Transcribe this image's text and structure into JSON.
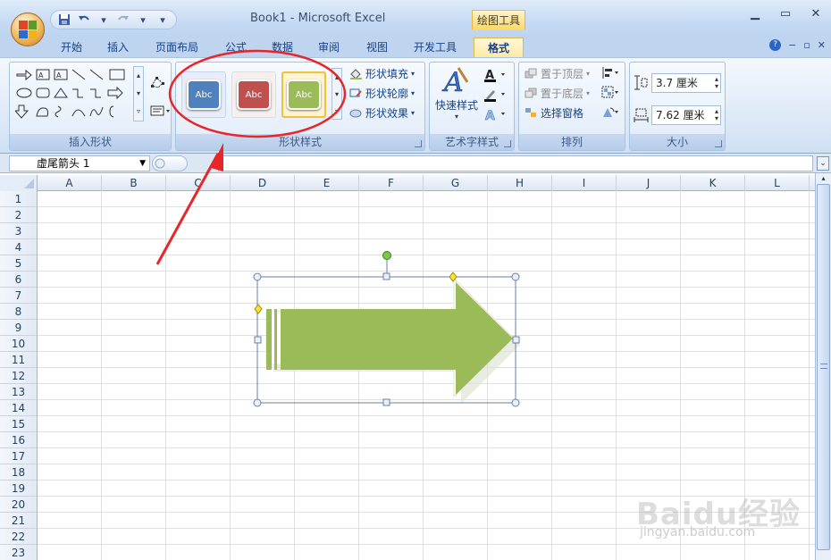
{
  "window": {
    "title": "Book1 - Microsoft Excel",
    "context_tab": "绘图工具",
    "min": "▁",
    "max": "▭",
    "close": "✕"
  },
  "qat": {
    "more": "▾"
  },
  "tabs": [
    "开始",
    "插入",
    "页面布局",
    "公式",
    "数据",
    "审阅",
    "视图",
    "开发工具",
    "格式"
  ],
  "ribbon_ctrl": {
    "help": "?",
    "min": "−",
    "restore": "▫",
    "close": "✕"
  },
  "groups": {
    "insert_shapes": {
      "label": "插入形状"
    },
    "shape_styles": {
      "label": "形状样式",
      "fill": "形状填充",
      "outline": "形状轮廓",
      "effects": "形状效果",
      "styles": [
        {
          "text": "Abc",
          "color": "#4f81bd"
        },
        {
          "text": "Abc",
          "color": "#c0504d"
        },
        {
          "text": "Abc",
          "color": "#9bbb59"
        }
      ]
    },
    "wordart": {
      "label": "艺术字样式",
      "quick": "快速样式"
    },
    "arrange": {
      "label": "排列",
      "front": "置于顶层",
      "back": "置于底层",
      "pane": "选择窗格"
    },
    "size": {
      "label": "大小",
      "height": "3.7 厘米",
      "width": "7.62 厘米"
    }
  },
  "formula_bar": {
    "name_box": "虚尾箭头 1",
    "formula": ""
  },
  "columns": [
    "A",
    "B",
    "C",
    "D",
    "E",
    "F",
    "G",
    "H",
    "I",
    "J",
    "K",
    "L"
  ],
  "rows": [
    "1",
    "2",
    "3",
    "4",
    "5",
    "6",
    "7",
    "8",
    "9",
    "10",
    "11",
    "12",
    "13",
    "14",
    "15",
    "16",
    "17",
    "18",
    "19",
    "20",
    "21",
    "22",
    "23"
  ],
  "shape": {
    "name": "虚尾箭头 1",
    "fill": "#9bbb59"
  },
  "watermark": {
    "main": "Baidu经验",
    "sub": "jingyan.baidu.com"
  },
  "colors": {
    "accent": "#15428b",
    "annotation": "#e8262a"
  }
}
